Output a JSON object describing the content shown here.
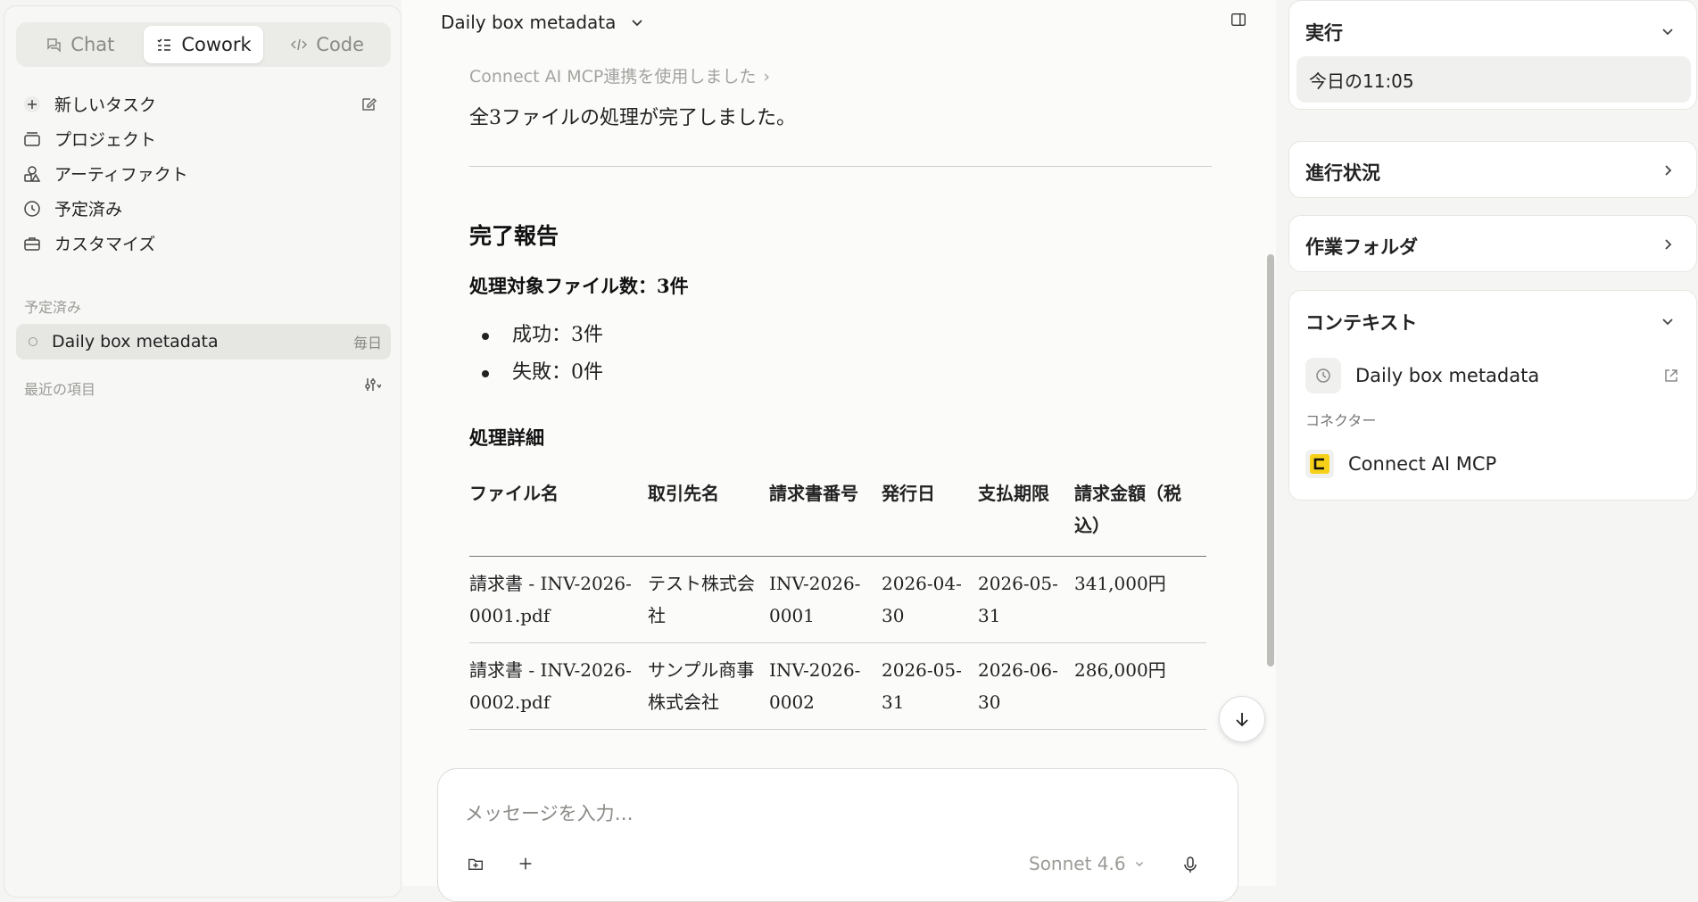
{
  "sidebar": {
    "modes": [
      {
        "label": "Chat",
        "icon": "chat-icon"
      },
      {
        "label": "Cowork",
        "icon": "checklist-icon",
        "active": true
      },
      {
        "label": "Code",
        "icon": "code-icon"
      }
    ],
    "nav": [
      {
        "label": "新しいタスク",
        "icon": "plus-icon"
      },
      {
        "label": "プロジェクト",
        "icon": "folder-icon"
      },
      {
        "label": "アーティファクト",
        "icon": "shapes-icon"
      },
      {
        "label": "予定済み",
        "icon": "clock-icon"
      },
      {
        "label": "カスタマイズ",
        "icon": "briefcase-icon"
      }
    ],
    "scheduled_label": "予定済み",
    "scheduled_item": {
      "label": "Daily box metadata",
      "freq": "毎日"
    },
    "recent_label": "最近の項目"
  },
  "header": {
    "title": "Daily box metadata"
  },
  "message": {
    "tool_use": "Connect AI MCP連携を使用しました",
    "intro": "全3ファイルの処理が完了しました。",
    "report_title": "完了報告",
    "count_heading": "処理対象ファイル数：3件",
    "bullets": [
      "成功：3件",
      "失敗：0件"
    ],
    "details_heading": "処理詳細",
    "table": {
      "headers": [
        "ファイル名",
        "取引先名",
        "請求書番号",
        "発行日",
        "支払期限",
        "請求金額（税込）"
      ],
      "rows": [
        [
          "請求書 - INV-2026-0001.pdf",
          "テスト株式会社",
          "INV-2026-0001",
          "2026-04-30",
          "2026-05-31",
          "341,000円"
        ],
        [
          "請求書 - INV-2026-0002.pdf",
          "サンプル商事株式会社",
          "INV-2026-0002",
          "2026-05-31",
          "2026-06-30",
          "286,000円"
        ]
      ]
    }
  },
  "composer": {
    "placeholder": "メッセージを入力…",
    "model": "Sonnet 4.6"
  },
  "right": {
    "run": {
      "title": "実行",
      "time": "今日の11:05"
    },
    "progress": {
      "title": "進行状況"
    },
    "folder": {
      "title": "作業フォルダ"
    },
    "context": {
      "title": "コンテキスト",
      "task": "Daily box metadata",
      "connector_label": "コネクター",
      "connector": "Connect AI MCP"
    }
  },
  "colors": {
    "accent": "#f7d117",
    "active_tab_bg": "#ffffff",
    "sidebar_bg": "#f7f7f5"
  }
}
